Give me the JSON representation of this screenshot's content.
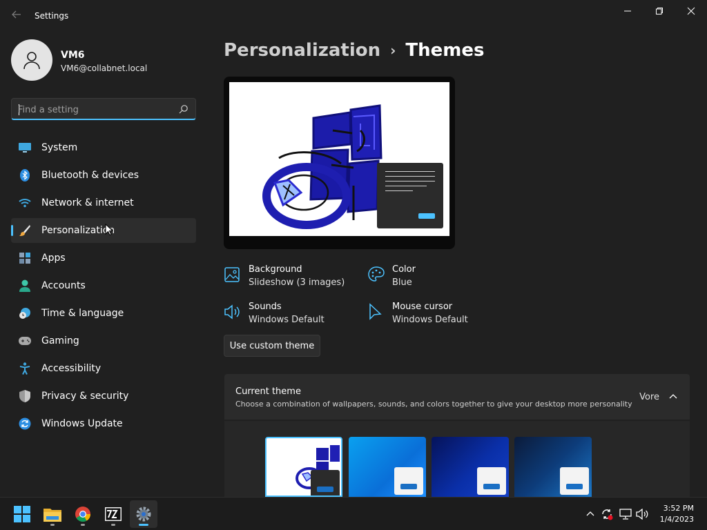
{
  "window": {
    "title": "Settings",
    "back_icon": "arrow-left-icon",
    "controls": [
      "minimize-icon",
      "restore-icon",
      "close-icon"
    ]
  },
  "profile": {
    "name": "VM6",
    "email": "VM6@collabnet.local"
  },
  "search": {
    "placeholder": "Find a setting",
    "value": ""
  },
  "sidebar": {
    "items": [
      {
        "label": "System",
        "icon": "monitor-icon",
        "active": false
      },
      {
        "label": "Bluetooth & devices",
        "icon": "bluetooth-icon",
        "active": false
      },
      {
        "label": "Network & internet",
        "icon": "wifi-icon",
        "active": false
      },
      {
        "label": "Personalization",
        "icon": "brush-icon",
        "active": true
      },
      {
        "label": "Apps",
        "icon": "apps-icon",
        "active": false
      },
      {
        "label": "Accounts",
        "icon": "person-icon",
        "active": false
      },
      {
        "label": "Time & language",
        "icon": "clock-globe-icon",
        "active": false
      },
      {
        "label": "Gaming",
        "icon": "gamepad-icon",
        "active": false
      },
      {
        "label": "Accessibility",
        "icon": "accessibility-icon",
        "active": false
      },
      {
        "label": "Privacy & security",
        "icon": "shield-icon",
        "active": false
      },
      {
        "label": "Windows Update",
        "icon": "sync-icon",
        "active": false
      }
    ]
  },
  "breadcrumb": {
    "parent": "Personalization",
    "separator": "›",
    "current": "Themes"
  },
  "theme_props": {
    "background": {
      "title": "Background",
      "value": "Slideshow (3 images)"
    },
    "color": {
      "title": "Color",
      "value": "Blue"
    },
    "sounds": {
      "title": "Sounds",
      "value": "Windows Default"
    },
    "mouse": {
      "title": "Mouse cursor",
      "value": "Windows Default"
    }
  },
  "custom_button": "Use custom theme",
  "current_theme": {
    "title": "Current theme",
    "description": "Choose a combination of wallpapers, sounds, and colors together to give your desktop more personality",
    "value": "Vore"
  },
  "colors": {
    "accent": "#4cc2ff",
    "background": "#202020",
    "card": "#2b2b2b",
    "drawing": "#1a1aa0"
  },
  "taskbar": {
    "apps": [
      "start-icon",
      "file-explorer-icon",
      "chrome-icon",
      "7zip-icon",
      "settings-icon"
    ],
    "active_app": "settings-icon",
    "time": "3:52 PM",
    "date": "1/4/2023"
  }
}
